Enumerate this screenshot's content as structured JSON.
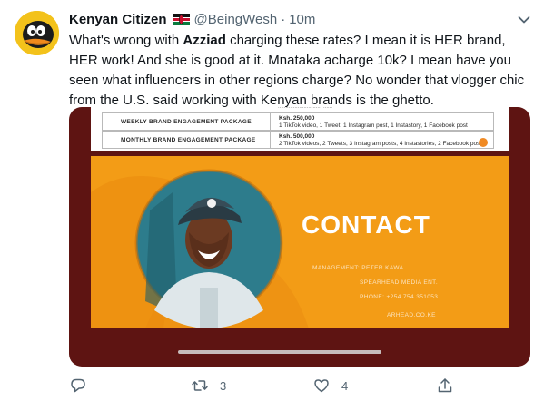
{
  "tweet": {
    "display_name": "Kenyan Citizen",
    "handle": "@BeingWesh",
    "separator": "·",
    "time": "10m",
    "flag_icon": "kenya-flag-icon",
    "text": {
      "t1": "What's wrong with ",
      "bold": "Azziad",
      "t2": " charging these rates? I mean it is HER brand, HER work! And she is good at it. Mnataka acharge 10k? I mean have you seen what influencers in other regions charge? No wonder that vlogger chic from the U.S. said working with Kenyan brands is the ghetto."
    }
  },
  "media": {
    "partial_line": "...................... ...... ......",
    "rows": [
      {
        "package": "WEEKLY BRAND ENGAGEMENT PACKAGE",
        "price": "Ksh. 250,000",
        "details": "1 TikTok video, 1 Tweet, 1 Instagram post, 1 Instastory, 1 Facebook post"
      },
      {
        "package": "MONTHLY BRAND ENGAGEMENT PACKAGE",
        "price": "Ksh. 500,000",
        "details": "2 TikTok videos, 2 Tweets, 3 Instagram posts, 4 Instastories, 2 Facebook posts"
      }
    ],
    "contact_title": "CONTACT",
    "management": "MANAGEMENT: PETER KAWA",
    "company": "SPEARHEAD MEDIA ENT.",
    "phone": "PHONE: +254 754 351053",
    "email_partial": "ARHEAD.CO.KE"
  },
  "actions": {
    "reply_icon": "reply-icon",
    "retweet_icon": "retweet-icon",
    "retweet_count": "3",
    "like_icon": "heart-icon",
    "like_count": "4",
    "share_icon": "share-icon"
  },
  "colors": {
    "accent_orange": "#f39c16",
    "frame_maroon": "#5e1412",
    "secondary_text": "#536471"
  }
}
